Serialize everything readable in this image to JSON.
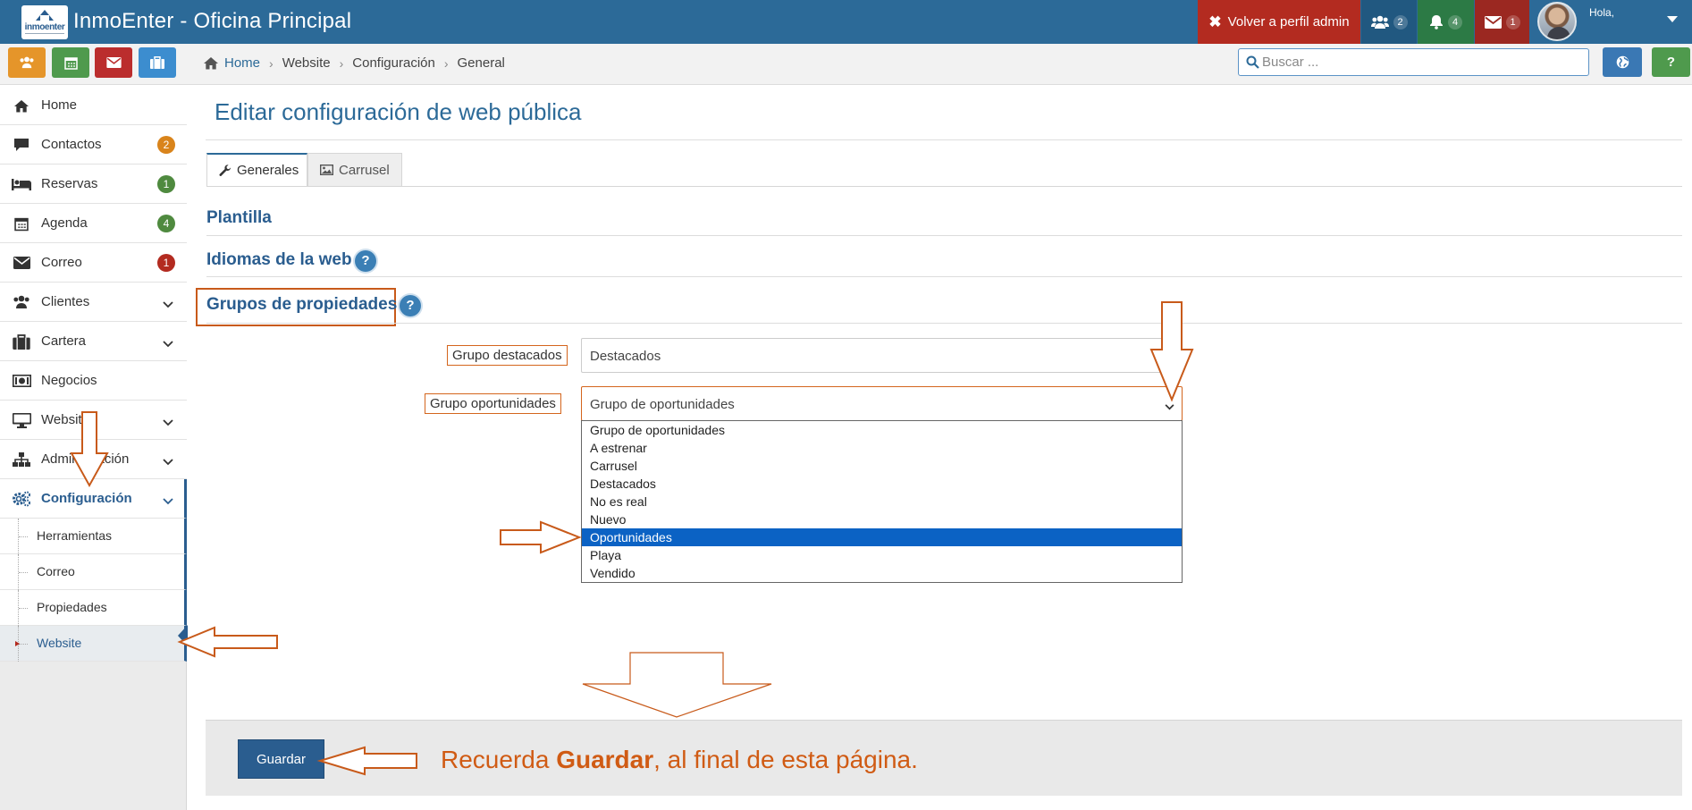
{
  "app": {
    "title": "InmoEnter - Oficina Principal",
    "logo_text": "inmoenter"
  },
  "topbar": {
    "admin_button": "Volver a perfil admin",
    "users_count": "2",
    "alerts_count": "4",
    "mail_count": "1",
    "greeting": "Hola,"
  },
  "breadcrumb": {
    "home": "Home",
    "items": [
      "Website",
      "Configuración",
      "General"
    ],
    "separator": "›"
  },
  "search": {
    "placeholder": "Buscar ..."
  },
  "help_label": "?",
  "sidebar": {
    "items": [
      {
        "label": "Home"
      },
      {
        "label": "Contactos",
        "count": "2"
      },
      {
        "label": "Reservas",
        "count": "1"
      },
      {
        "label": "Agenda",
        "count": "4"
      },
      {
        "label": "Correo",
        "count": "1"
      },
      {
        "label": "Clientes"
      },
      {
        "label": "Cartera"
      },
      {
        "label": "Negocios"
      },
      {
        "label": "Website"
      },
      {
        "label": "Administración"
      },
      {
        "label": "Configuración"
      }
    ],
    "submenu": [
      "Herramientas",
      "Correo",
      "Propiedades",
      "Website"
    ]
  },
  "colors": {
    "accent": "#2c6a98",
    "badge_orange": "#d9841b",
    "badge_green": "#4f8a3f",
    "badge_red": "#b32b20",
    "annotation": "#c85a1a"
  },
  "main": {
    "page_title": "Editar configuración de web pública",
    "tabs": [
      {
        "label": "Generales",
        "icon": "wrench-icon"
      },
      {
        "label": "Carrusel",
        "icon": "image-icon"
      }
    ],
    "sections": {
      "plantilla": "Plantilla",
      "idiomas": "Idiomas de la web",
      "grupos": "Grupos de propiedades"
    },
    "form": {
      "destacados_label": "Grupo destacados",
      "destacados_value": "Destacados",
      "oportunidades_label": "Grupo oportunidades",
      "oportunidades_value": "Grupo de oportunidades"
    },
    "dropdown_options": [
      "Grupo de oportunidades",
      "A estrenar",
      "Carrusel",
      "Destacados",
      "No es real",
      "Nuevo",
      "Oportunidades",
      "Playa",
      "Vendido"
    ],
    "dropdown_highlighted": "Oportunidades",
    "save_label": "Guardar",
    "reminder_pre": "Recuerda ",
    "reminder_bold": "Guardar",
    "reminder_post": ", al final de esta página."
  }
}
